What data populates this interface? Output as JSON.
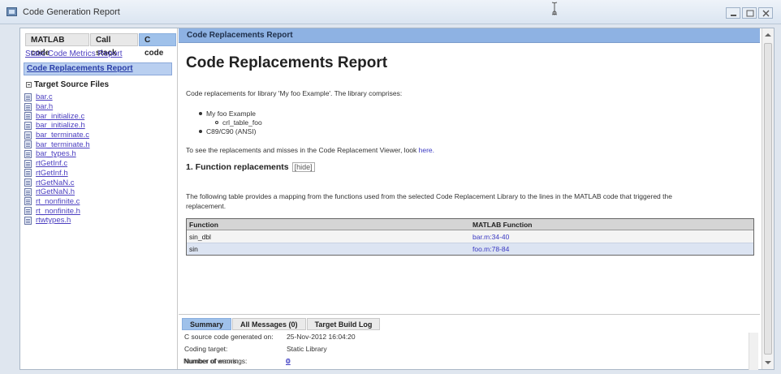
{
  "window": {
    "title": "Code Generation Report"
  },
  "left": {
    "tabs": [
      {
        "label": "MATLAB code",
        "active": false
      },
      {
        "label": "Call stack",
        "active": false
      },
      {
        "label": "C code",
        "active": true
      }
    ],
    "links": [
      "Static Code Metrics Report",
      "Code Replacements Report"
    ],
    "tree_title": "Target Source Files",
    "files": [
      "bar.c",
      "bar.h",
      "bar_initialize.c",
      "bar_initialize.h",
      "bar_terminate.c",
      "bar_terminate.h",
      "bar_types.h",
      "rtGetInf.c",
      "rtGetInf.h",
      "rtGetNaN.c",
      "rtGetNaN.h",
      "rt_nonfinite.c",
      "rt_nonfinite.h",
      "rtwtypes.h"
    ]
  },
  "main": {
    "header": "Code Replacements Report",
    "title": "Code Replacements Report",
    "intro": "Code replacements for library 'My foo Example'. The library comprises:",
    "libraries": [
      {
        "name": "My foo Example",
        "children": [
          "crl_table_foo"
        ]
      },
      {
        "name": "C89/C90 (ANSI)",
        "children": []
      }
    ],
    "viewer_text": "To see the replacements and misses in the Code Replacement Viewer, look ",
    "viewer_link": "here.",
    "section_title": "1. Function replacements",
    "hide_label": "[hide]",
    "table_desc_1": "The following table provides a mapping from the functions used from the selected Code Replacement Library to the lines in the MATLAB code that triggered the",
    "table_desc_2": "replacement.",
    "table": {
      "headers": [
        "Function",
        "MATLAB Function"
      ],
      "rows": [
        [
          "sin_dbl",
          "bar.m:34-40"
        ],
        [
          "sin",
          "foo.m:78-84"
        ]
      ]
    }
  },
  "bottom": {
    "tabs": [
      {
        "label": "Summary",
        "active": true
      },
      {
        "label": "All Messages (0)",
        "active": false
      },
      {
        "label": "Target Build Log",
        "active": false
      }
    ],
    "rows": [
      {
        "label": "C source code generated on:",
        "value": "25-Nov-2012 16:04:20"
      },
      {
        "label": "Coding target:",
        "value": "Static Library"
      },
      {
        "label": "Number of errors:",
        "value": "0"
      },
      {
        "label": "Number of warnings:",
        "value": "0"
      }
    ]
  }
}
